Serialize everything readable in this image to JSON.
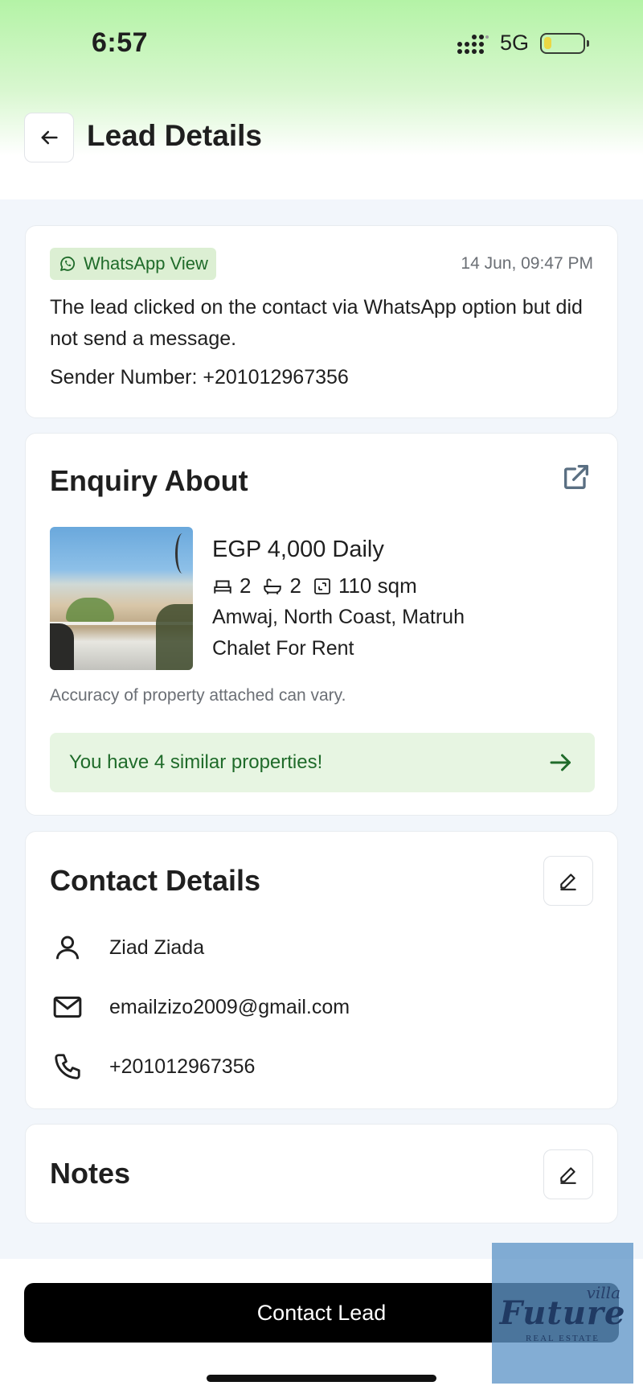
{
  "status_bar": {
    "time": "6:57",
    "network": "5G",
    "battery_level": 0.2
  },
  "header": {
    "title": "Lead Details",
    "back_icon": "arrow-left-icon"
  },
  "activity": {
    "badge_label": "WhatsApp View",
    "timestamp": "14 Jun, 09:47 PM",
    "description": "The lead clicked on the contact via WhatsApp option but did not send a message.",
    "sender_label": "Sender Number: ",
    "sender_number": "+201012967356"
  },
  "enquiry": {
    "title": "Enquiry About",
    "price": "EGP 4,000 Daily",
    "bedrooms": "2",
    "bathrooms": "2",
    "area": "110 sqm",
    "location": "Amwaj, North Coast, Matruh",
    "type": "Chalet For Rent",
    "accuracy_note": "Accuracy of property attached can vary.",
    "similar_text": "You have 4 similar properties!"
  },
  "contact": {
    "title": "Contact Details",
    "name": "Ziad Ziada",
    "email": "emailzizo2009@gmail.com",
    "phone": "+201012967356"
  },
  "notes": {
    "title": "Notes"
  },
  "footer": {
    "cta_label": "Contact Lead"
  },
  "watermark": {
    "line1": "villa",
    "line2": "Future",
    "line3": "REAL ESTATE"
  },
  "colors": {
    "brand_green": "#1f6b2a",
    "badge_bg": "#dcefd3",
    "cta_bg": "#000000"
  }
}
